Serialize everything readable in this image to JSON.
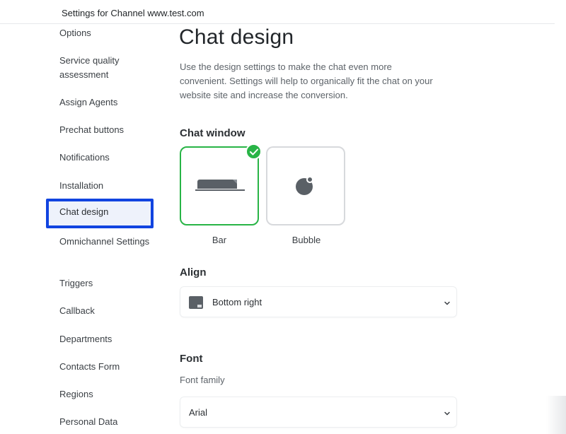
{
  "window": {
    "title": "Settings for Channel www.test.com"
  },
  "sidebar": {
    "items": [
      {
        "label": "Options"
      },
      {
        "label": "Service quality assessment"
      },
      {
        "label": "Assign Agents"
      },
      {
        "label": "Prechat buttons"
      },
      {
        "label": "Notifications"
      },
      {
        "label": "Installation"
      },
      {
        "label": "Chat design",
        "active": true
      },
      {
        "label": "Omnichannel Settings"
      },
      {
        "label": "Triggers"
      },
      {
        "label": "Callback"
      },
      {
        "label": "Departments"
      },
      {
        "label": "Contacts Form"
      },
      {
        "label": "Regions"
      },
      {
        "label": "Personal Data"
      }
    ],
    "active_highlight_color": "#1144e0"
  },
  "main": {
    "title": "Chat design",
    "description": "Use the design settings to make the chat even more convenient. Settings will help to organically fit the chat on your website site and increase the conversion.",
    "chat_window": {
      "heading": "Chat window",
      "options": [
        {
          "label": "Bar",
          "selected": true,
          "icon": "bar-icon"
        },
        {
          "label": "Bubble",
          "selected": false,
          "icon": "bubble-icon"
        }
      ],
      "selected_color": "#28b446"
    },
    "align": {
      "heading": "Align",
      "value": "Bottom right",
      "icon": "align-bottom-right-icon"
    },
    "font": {
      "heading": "Font",
      "family_label": "Font family",
      "family_value": "Arial"
    }
  }
}
